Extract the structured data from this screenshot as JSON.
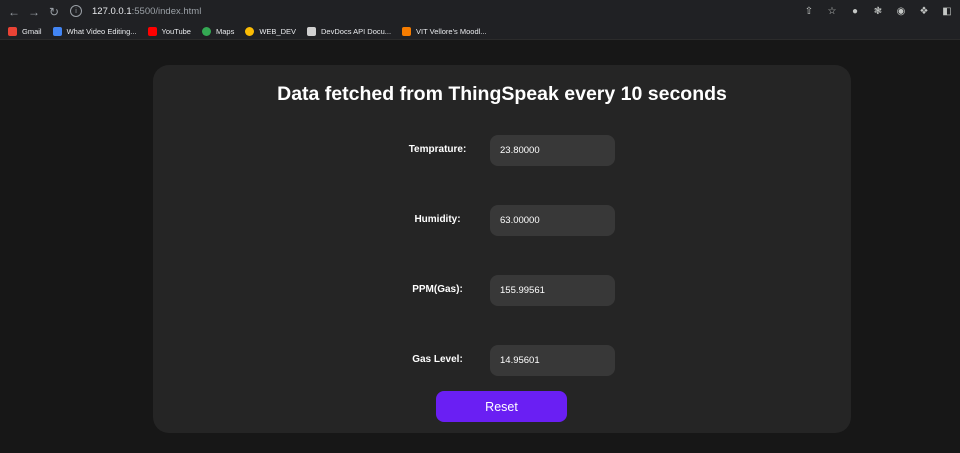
{
  "browser": {
    "url_host": "127.0.0.1",
    "url_rest": ":5500/index.html",
    "bookmarks": [
      {
        "label": "Gmail",
        "color": "#ea4335"
      },
      {
        "label": "What Video Editing...",
        "color": "#4285f4"
      },
      {
        "label": "YouTube",
        "color": "#ff0000"
      },
      {
        "label": "Maps",
        "color": "#34a853"
      },
      {
        "label": "WEB_DEV",
        "color": "#fbbc04"
      },
      {
        "label": "DevDocs API Docu...",
        "color": "#d0d0d0"
      },
      {
        "label": "VIT Vellore's Moodl...",
        "color": "#f57c00"
      }
    ]
  },
  "page": {
    "title": "Data fetched from ThingSpeak every 10 seconds",
    "fields": [
      {
        "label": "Temprature:",
        "value": "23.80000"
      },
      {
        "label": "Humidity:",
        "value": "63.00000"
      },
      {
        "label": "PPM(Gas):",
        "value": "155.99561"
      },
      {
        "label": "Gas Level:",
        "value": "14.95601"
      }
    ],
    "reset_label": "Reset"
  },
  "colors": {
    "accent": "#6a1ff3",
    "card": "#252525",
    "field": "#383838",
    "background": "#171717"
  }
}
